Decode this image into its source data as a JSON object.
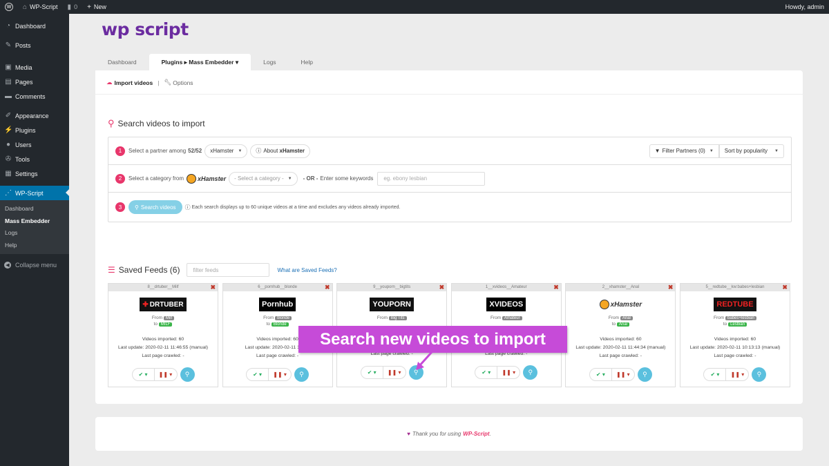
{
  "adminbar": {
    "site_name": "WP-Script",
    "comments_count": "0",
    "new_label": "New",
    "howdy": "Howdy, admin"
  },
  "sidebar": {
    "items": [
      {
        "label": "Dashboard",
        "icon": "dashboard-icon"
      },
      {
        "label": "Posts",
        "icon": "pin-icon"
      },
      {
        "label": "Media",
        "icon": "media-icon"
      },
      {
        "label": "Pages",
        "icon": "page-icon"
      },
      {
        "label": "Comments",
        "icon": "comment-icon"
      },
      {
        "label": "Appearance",
        "icon": "brush-icon"
      },
      {
        "label": "Plugins",
        "icon": "plugin-icon"
      },
      {
        "label": "Users",
        "icon": "user-icon"
      },
      {
        "label": "Tools",
        "icon": "wrench-icon"
      },
      {
        "label": "Settings",
        "icon": "settings-icon"
      }
    ],
    "active_item": "WP-Script",
    "submenu": [
      "Dashboard",
      "Mass Embedder",
      "Logs",
      "Help"
    ],
    "collapse_label": "Collapse menu"
  },
  "logo": {
    "text": "wp script"
  },
  "tabs": [
    {
      "label": "Dashboard"
    },
    {
      "label": "Plugins ▸ Mass Embedder ▾"
    },
    {
      "label": "Logs"
    },
    {
      "label": "Help"
    }
  ],
  "subnav": {
    "import_label": "Import videos",
    "separator": "|",
    "options_label": "Options"
  },
  "search_section": {
    "title": "Search videos to import",
    "step1": {
      "number": "1",
      "label": "Select a partner among",
      "count": "52/52",
      "partner": "xHamster",
      "about_label": "About",
      "about_partner": "xHamster",
      "filter_label": "Filter Partners (0)",
      "sort_label": "Sort by popularity"
    },
    "step2": {
      "number": "2",
      "label": "Select a category from",
      "logo_text": "xHamster",
      "category_placeholder": "- Select a category -",
      "or_label": "- OR -",
      "keywords_label": "Enter some keywords",
      "keywords_placeholder": "eg. ebony lesbian"
    },
    "step3": {
      "number": "3",
      "button_label": "Search videos",
      "info": "Each search displays up to 60 unique videos at a time and excludes any videos already imported."
    }
  },
  "saved_feeds": {
    "title": "Saved Feeds (6)",
    "filter_placeholder": "filter feeds",
    "what_link": "What are Saved Feeds?",
    "feeds": [
      {
        "header": "8__drtuber__Milf",
        "brand": "DRTUBER",
        "brand_sub": "FIND YOUR PORN",
        "from_tag": "Milf",
        "to_tag": "MILF",
        "imported": "Videos imported: 60",
        "last_update": "Last update: 2020-02-11 11:46:55 (manual)",
        "last_page": "Last page crawled: -"
      },
      {
        "header": "6__pornhub__blonde",
        "brand": "Pornhub",
        "from_tag": "blonde",
        "to_tag": "Blonde",
        "imported": "Videos imported: 60",
        "last_update": "Last update: 2020-02-11 11:46:",
        "last_page": "Last page crawled: -"
      },
      {
        "header": "9__youporn__bigtits",
        "brand": "YOUPORN",
        "from_tag": "Big Tits",
        "to_tag": "",
        "imported": "",
        "last_update": "",
        "last_page": "Last page crawled: -"
      },
      {
        "header": "1__xvideos__Amateur",
        "brand": "XVIDEOS",
        "from_tag": "Amateur",
        "to_tag": "",
        "imported": "",
        "last_update": "",
        "last_page": "Last page crawled: -"
      },
      {
        "header": "2__xhamster__Anal",
        "brand": "xHamster",
        "from_tag": "Anal",
        "to_tag": "Anal",
        "imported": "Videos imported: 60",
        "last_update": "Last update: 2020-02-11 11:44:34 (manual)",
        "last_page": "Last page crawled: -"
      },
      {
        "header": "5__redtube__kw:babes+lesbian",
        "brand": "REDTUBE",
        "from_tag": "babes+lesbian",
        "to_tag": "Lesbian",
        "imported": "Videos imported: 60",
        "last_update": "Last update: 2020-02-11 10:13:13 (manual)",
        "last_page": "Last page crawled: -"
      }
    ],
    "from_label": "From",
    "to_label": "to"
  },
  "callout": {
    "text": "Search new videos to import"
  },
  "footer": {
    "text": "Thank you for using",
    "brand": "WP-Script",
    "suffix": "."
  },
  "colors": {
    "accent": "#e8366b",
    "brand_purple": "#6b2ca0",
    "wp_blue": "#0073aa",
    "callout": "#c64bd8"
  }
}
